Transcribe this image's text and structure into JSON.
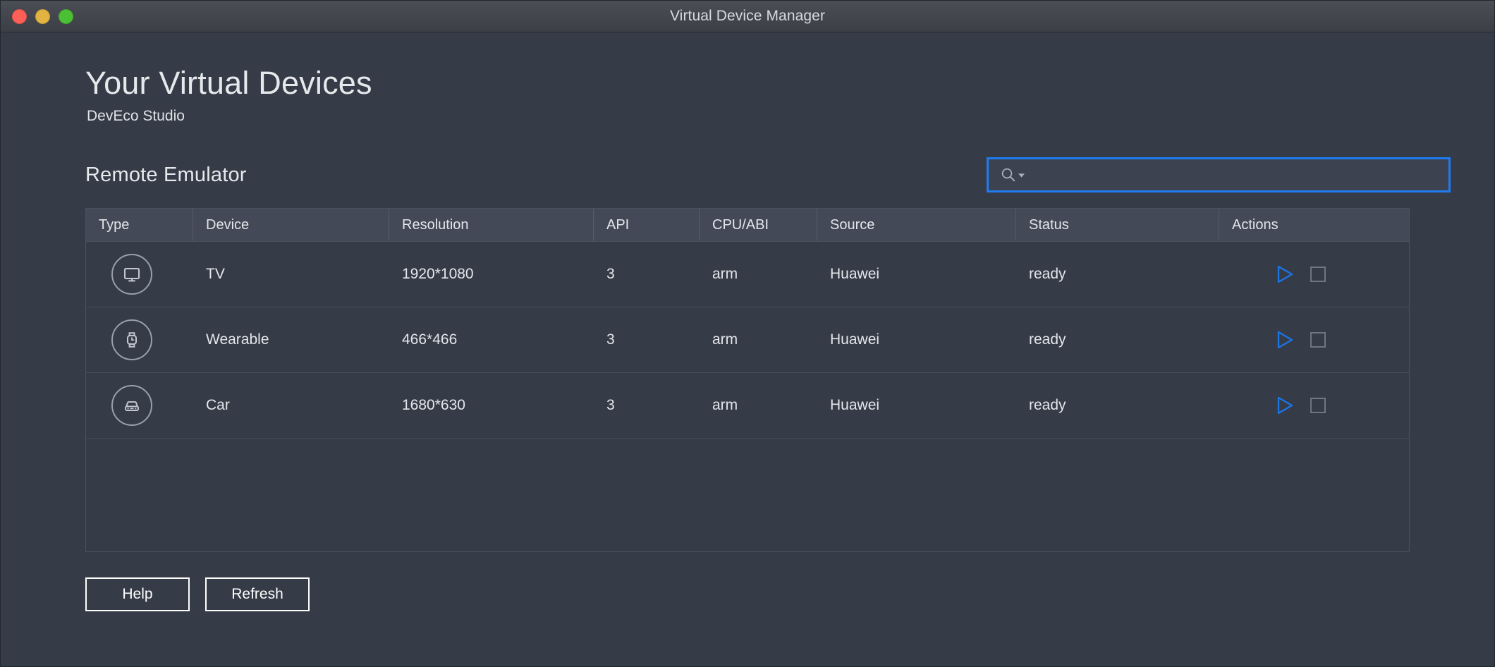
{
  "window": {
    "title": "Virtual Device Manager",
    "traffic_lights": [
      {
        "name": "close",
        "color": "#ff5f57"
      },
      {
        "name": "minimize",
        "color": "#e3b341"
      },
      {
        "name": "maximize",
        "color": "#4cc034"
      }
    ]
  },
  "header": {
    "title": "Your Virtual Devices",
    "subtitle": "DevEco Studio"
  },
  "section": {
    "title": "Remote Emulator"
  },
  "search": {
    "value": "",
    "placeholder": "",
    "icon": "search-icon",
    "dropdown_icon": "caret-down-icon",
    "focus_color": "#1e7cf0"
  },
  "table": {
    "columns": [
      {
        "key": "type",
        "label": "Type"
      },
      {
        "key": "device",
        "label": "Device"
      },
      {
        "key": "resolution",
        "label": "Resolution"
      },
      {
        "key": "api",
        "label": "API"
      },
      {
        "key": "cpu_abi",
        "label": "CPU/ABI"
      },
      {
        "key": "source",
        "label": "Source"
      },
      {
        "key": "status",
        "label": "Status"
      },
      {
        "key": "actions",
        "label": "Actions"
      }
    ],
    "rows": [
      {
        "icon": "tv-monitor-icon",
        "device": "TV",
        "resolution": "1920*1080",
        "api": "3",
        "cpu_abi": "arm",
        "source": "Huawei",
        "status": "ready",
        "actions": [
          "play-icon",
          "stop-icon"
        ]
      },
      {
        "icon": "watch-icon",
        "device": "Wearable",
        "resolution": "466*466",
        "api": "3",
        "cpu_abi": "arm",
        "source": "Huawei",
        "status": "ready",
        "actions": [
          "play-icon",
          "stop-icon"
        ]
      },
      {
        "icon": "car-icon",
        "device": "Car",
        "resolution": "1680*630",
        "api": "3",
        "cpu_abi": "arm",
        "source": "Huawei",
        "status": "ready",
        "actions": [
          "play-icon",
          "stop-icon"
        ]
      }
    ]
  },
  "footer": {
    "help_label": "Help",
    "refresh_label": "Refresh"
  },
  "colors": {
    "window_bg": "#353b47",
    "titlebar_bg": "#43474d",
    "table_header_bg": "#434956",
    "accent_blue": "#1e7cf0",
    "play_blue": "#1b74e4",
    "text_primary": "#e6e9ec"
  }
}
